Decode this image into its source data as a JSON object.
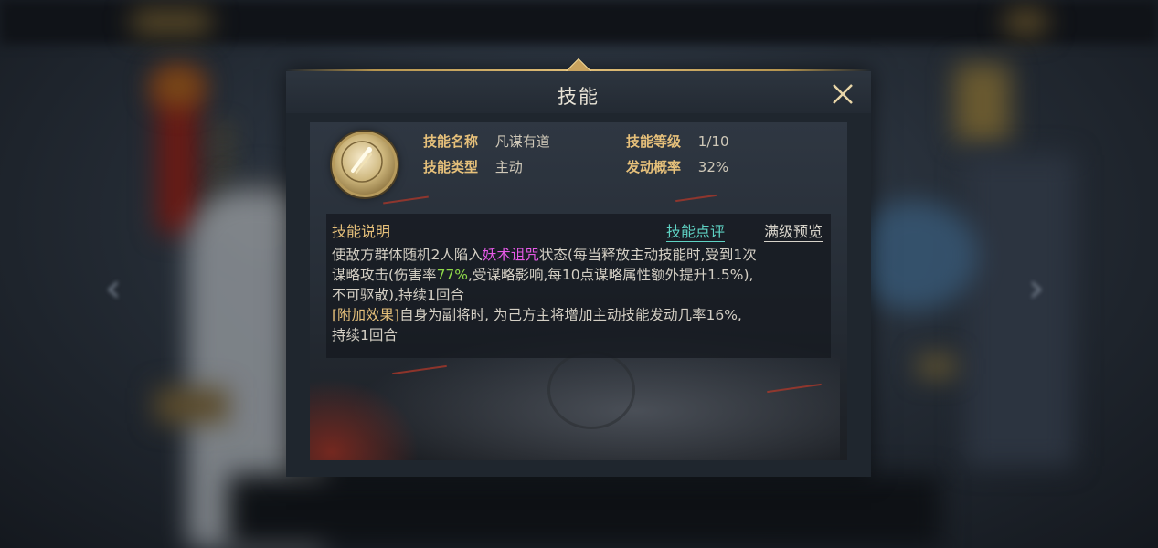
{
  "dialog": {
    "title": "技能",
    "close_icon": "close-icon"
  },
  "skill": {
    "icon": "skill-emblem-icon",
    "name_label": "技能名称",
    "name_value": "凡谋有道",
    "level_label": "技能等级",
    "level_value": "1/10",
    "type_label": "技能类型",
    "type_value": "主动",
    "chance_label": "发动概率",
    "chance_value": "32%"
  },
  "description": {
    "title": "技能说明",
    "review_link": "技能点评",
    "preview_link": "满级预览",
    "line1_a": "使敌方群体随机2人陷入",
    "line1_status": "妖术诅咒",
    "line1_b": "状态(每当释放主动技能时,受到1次",
    "line2_a": "谋略攻击(伤害率",
    "line2_rate": "77%",
    "line2_b": ",受谋略影响,每10点谋略属性额外提升1.5%),",
    "line3": "不可驱散),持续1回合",
    "line4_tag": "[附加效果]",
    "line4_b": "自身为副将时, 为己方主将增加主动技能发动几率16%,",
    "line5": "持续1回合"
  },
  "colors": {
    "accent_gold": "#e6c07a",
    "link_teal": "#5fd3c4",
    "status_magenta": "#e65ae6",
    "rate_green": "#8fd94a"
  }
}
